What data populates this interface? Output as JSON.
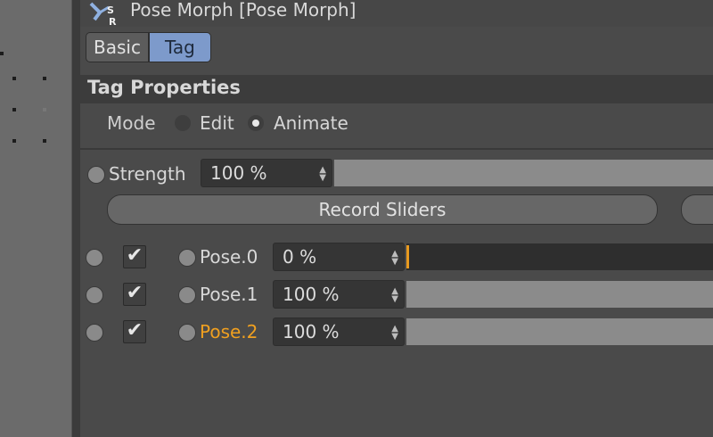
{
  "header": {
    "title": "Pose Morph [Pose Morph]",
    "icon": "pose-morph-tag-icon",
    "icon_letters": {
      "top": "S",
      "bottom": "R"
    }
  },
  "tabs": [
    {
      "label": "Basic",
      "active": false
    },
    {
      "label": "Tag",
      "active": true
    }
  ],
  "section": {
    "title": "Tag Properties"
  },
  "mode": {
    "label": "Mode",
    "options": [
      {
        "label": "Edit",
        "selected": false
      },
      {
        "label": "Animate",
        "selected": true
      }
    ]
  },
  "strength": {
    "label": "Strength",
    "value": "100 %",
    "fraction": 1.0
  },
  "buttons": {
    "record_sliders": "Record Sliders"
  },
  "poses": [
    {
      "name": "Pose.0",
      "value": "0 %",
      "fraction": 0.0,
      "checked": true,
      "highlighted": false
    },
    {
      "name": "Pose.1",
      "value": "100 %",
      "fraction": 1.0,
      "checked": true,
      "highlighted": false
    },
    {
      "name": "Pose.2",
      "value": "100 %",
      "fraction": 1.0,
      "checked": true,
      "highlighted": true
    }
  ],
  "colors": {
    "accent_tab": "#7d9acb",
    "highlight_text": "#f0a020",
    "slider_fill": "#8b8b8b"
  }
}
